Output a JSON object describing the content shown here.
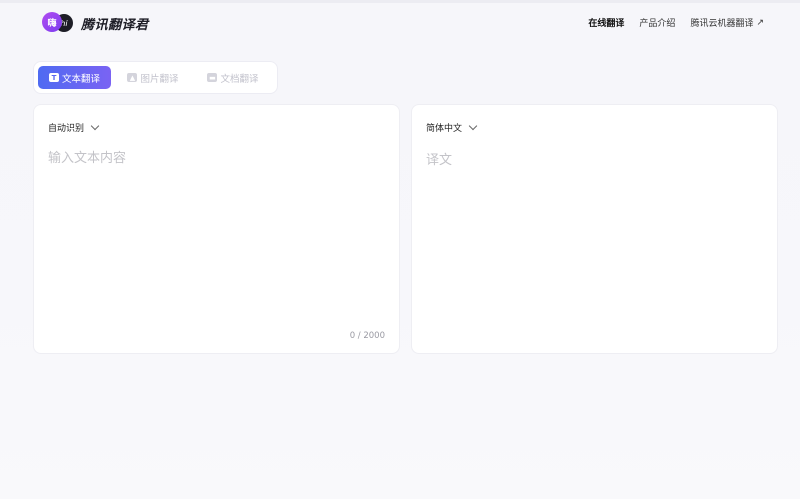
{
  "header": {
    "logo_c1": "嗨",
    "logo_c2": "hi",
    "logo_text": "腾讯翻译君",
    "nav": [
      {
        "label": "在线翻译"
      },
      {
        "label": "产品介绍"
      },
      {
        "label": "腾讯云机器翻译",
        "icon": "external-link-icon"
      }
    ]
  },
  "tabs": [
    {
      "label": "文本翻译",
      "icon": "text-icon",
      "active": true
    },
    {
      "label": "图片翻译",
      "icon": "image-icon",
      "active": false
    },
    {
      "label": "文档翻译",
      "icon": "document-icon",
      "active": false
    }
  ],
  "source": {
    "language": "自动识别",
    "placeholder": "输入文本内容",
    "value": "",
    "counter": "0 / 2000"
  },
  "target": {
    "language": "简体中文",
    "placeholder": "译文"
  },
  "colors": {
    "accent_start": "#4f6bf2",
    "accent_end": "#7a63f3",
    "logo_purple": "#b14cf0"
  }
}
